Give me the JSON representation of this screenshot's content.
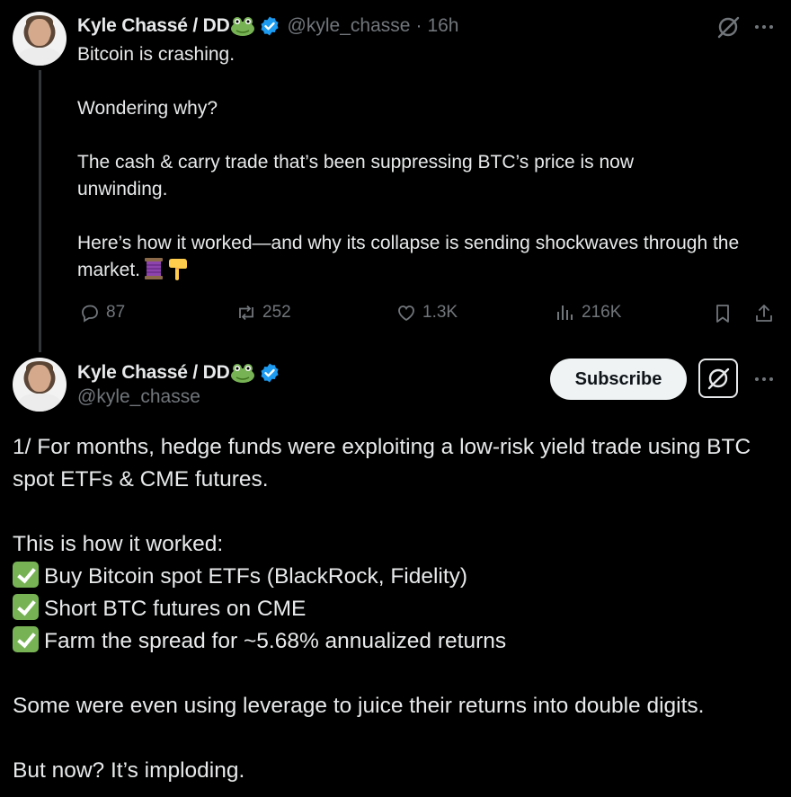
{
  "tweet1": {
    "author_name": "Kyle Chassé / DD",
    "handle": "@kyle_chasse",
    "separator": "·",
    "time": "16h",
    "paragraphs": [
      "Bitcoin is crashing.",
      "Wondering why?",
      "The cash & carry trade that’s been suppressing BTC’s price is now unwinding.",
      "Here’s how it worked—and why its collapse is sending shockwaves through the market."
    ],
    "emojis": [
      "spool-of-thread-emoji",
      "backhand-index-pointing-down-emoji"
    ],
    "actions": {
      "replies": "87",
      "reposts": "252",
      "likes": "1.3K",
      "views": "216K"
    }
  },
  "tweet2": {
    "author_name": "Kyle Chassé / DD",
    "handle": "@kyle_chasse",
    "subscribe_label": "Subscribe",
    "intro": "1/ For months, hedge funds were exploiting a low-risk yield trade using BTC spot ETFs & CME futures.",
    "list_heading": "This is how it worked:",
    "list_items": [
      "Buy Bitcoin spot ETFs (BlackRock, Fidelity)",
      "Short BTC futures on CME",
      "Farm the spread for ~5.68% annualized returns"
    ],
    "leverage_line": "Some were even using leverage to juice their returns into double digits.",
    "closing": "But now? It’s imploding."
  },
  "colors": {
    "background": "#000000",
    "text": "#e7e9ea",
    "muted": "#71767b",
    "verified_blue": "#1d9bf0",
    "check_green": "#77b255"
  }
}
